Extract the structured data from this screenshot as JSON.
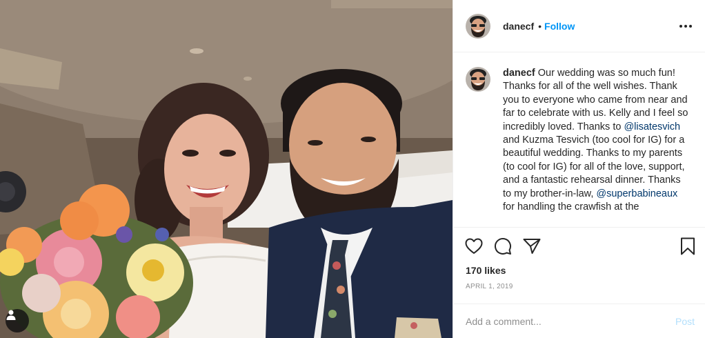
{
  "post": {
    "username": "danecf",
    "follow_label": "Follow",
    "dot": "•",
    "caption_parts": [
      "Our wedding was so much fun! Thanks for all of the well wishes. Thank you to everyone who came from near and far to celebrate with us. Kelly and I feel so incredibly loved. Thanks to ",
      " and Kuzma Tesvich (too cool for IG) for a beautiful wedding. Thanks to my parents (to cool for IG) for all of the love, support, and a fantastic rehearsal dinner. Thanks to my brother-in-law, ",
      " for handling the crawfish at the"
    ],
    "mentions": [
      "@lisatesvich",
      "@superbabineaux"
    ],
    "likes": "170 likes",
    "date": "APRIL 1, 2019",
    "comment_placeholder": "Add a comment...",
    "post_label": "Post"
  },
  "icons": {
    "more": "more-options-icon",
    "like": "heart-icon",
    "comment": "comment-icon",
    "share": "share-icon",
    "save": "bookmark-icon",
    "tag": "user-tag-icon"
  },
  "colors": {
    "follow": "#0095f6",
    "mention": "#00376b",
    "muted": "#8e8e8e",
    "post_disabled": "#b2dffc"
  }
}
